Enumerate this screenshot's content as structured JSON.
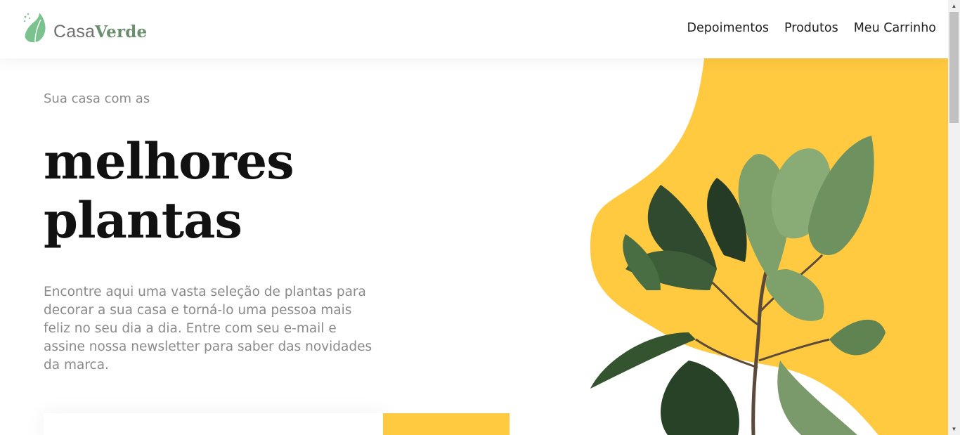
{
  "brand": {
    "name_light": "Casa",
    "name_bold": "Verde",
    "logo_icon": "leaf-icon",
    "color": "#6b8f6e"
  },
  "nav": {
    "items": [
      {
        "label": "Depoimentos"
      },
      {
        "label": "Produtos"
      },
      {
        "label": "Meu Carrinho"
      }
    ]
  },
  "hero": {
    "subtitle": "Sua casa com as",
    "title_line1": "melhores",
    "title_line2": "plantas",
    "description": "Encontre aqui uma vasta seleção de plantas para decorar a sua casa e torná-lo uma pessoa mais feliz no seu dia a dia. Entre com seu e-mail e assine nossa newsletter para saber das novidades da marca.",
    "accent_color": "#ffc940",
    "image": "fiddle-leaf-fig-plant"
  },
  "newsletter": {
    "placeholder": "",
    "button_label": ""
  },
  "scrollbar": {
    "up_icon": "▲",
    "down_icon": "▼"
  }
}
